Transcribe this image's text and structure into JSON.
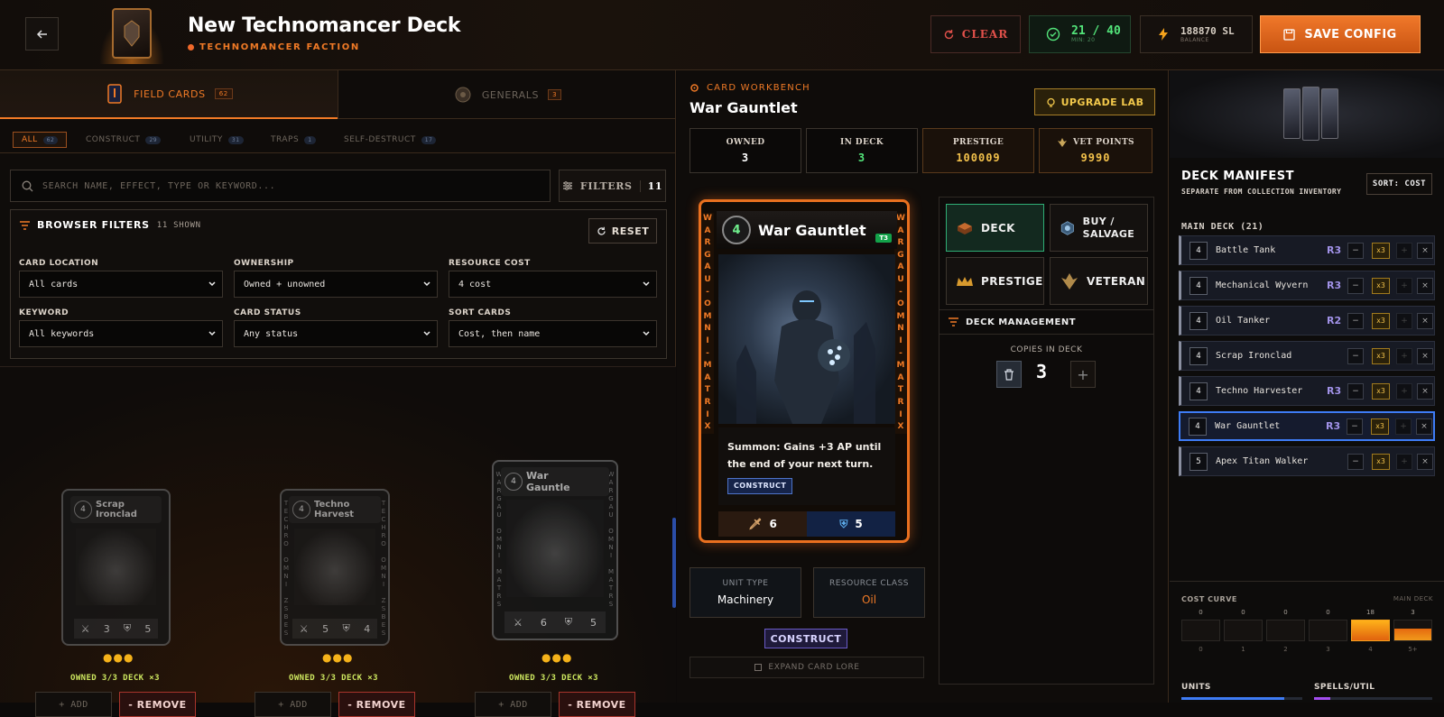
{
  "header": {
    "title": "New Technomancer Deck",
    "faction": "TECHNOMANCER FACTION",
    "clear_label": "CLEAR",
    "count": "21 / 40",
    "count_min": "MIN: 20",
    "balance": "188870 SL",
    "balance_label": "BALANCE",
    "save_label": "SAVE CONFIG"
  },
  "tabs": [
    {
      "label": "FIELD CARDS",
      "count": "62"
    },
    {
      "label": "GENERALS",
      "count": "3"
    }
  ],
  "subtabs": [
    {
      "label": "ALL",
      "count": "62"
    },
    {
      "label": "CONSTRUCT",
      "count": "29"
    },
    {
      "label": "UTILITY",
      "count": "31"
    },
    {
      "label": "TRAPS",
      "count": "1"
    },
    {
      "label": "SELF-DESTRUCT",
      "count": "17"
    }
  ],
  "search": {
    "placeholder": "SEARCH NAME, EFFECT, TYPE OR KEYWORD..."
  },
  "filters": {
    "button_label": "FILTERS",
    "button_count": "11",
    "panel_title": "BROWSER FILTERS",
    "shown": "11 SHOWN",
    "reset_label": "RESET",
    "fields": [
      {
        "label": "CARD LOCATION",
        "value": "All cards"
      },
      {
        "label": "OWNERSHIP",
        "value": "Owned + unowned"
      },
      {
        "label": "RESOURCE COST",
        "value": "4 cost"
      },
      {
        "label": "KEYWORD",
        "value": "All keywords"
      },
      {
        "label": "CARD STATUS",
        "value": "Any status"
      },
      {
        "label": "SORT CARDS",
        "value": "Cost, then name"
      }
    ]
  },
  "cards": [
    {
      "cost": "4",
      "name_1": "Scrap",
      "name_2": "Ironclad",
      "atk": "3",
      "def": "5",
      "owned": "OWNED 3/3 DECK ×3",
      "add": "+ ADD",
      "remove": "- REMOVE",
      "side": "T\nE\nC\nH\nN\nO\n \nZ\nB\nS\nE\nS"
    },
    {
      "cost": "4",
      "name_1": "Techno",
      "name_2": "Harvest",
      "tier": "T3",
      "atk": "5",
      "def": "4",
      "owned": "OWNED 3/3 DECK ×3",
      "add": "+ ADD",
      "remove": "- REMOVE",
      "side": "T\nE\nC\nH\nR\nO\n \nO\nM\nN\nI\n \nZ\nS\nB\nE\nS"
    },
    {
      "cost": "4",
      "name_1": "War",
      "name_2": "Gauntle",
      "tier": "T3",
      "atk": "6",
      "def": "5",
      "owned": "OWNED 3/3 DECK ×3",
      "add": "+ ADD",
      "remove": "- REMOVE",
      "side": "W\nA\nR\nG\nA\nU\n \nO\nM\nN\nI\n \nM\nA\nT\nR\nS"
    }
  ],
  "workbench": {
    "label": "CARD WORKBENCH",
    "title": "War Gauntlet",
    "upgrade_label": "UPGRADE LAB",
    "stats": [
      {
        "label": "OWNED",
        "value": "3"
      },
      {
        "label": "IN DECK",
        "value": "3"
      },
      {
        "label": "PRESTIGE",
        "value": "100009"
      },
      {
        "label": "VET POINTS",
        "value": "9990"
      }
    ],
    "card": {
      "cost": "4",
      "name": "War Gauntlet",
      "tier": "T3",
      "side_text": "W\nA\nR\nG\nA\nU\n-\nO\nM\nN\nI\n-\nM\nA\nT\nR\nI\nX",
      "text": "Summon: Gains +3 AP until the end of your next turn.",
      "tag": "CONSTRUCT",
      "atk": "6",
      "def": "5"
    },
    "unit_type_label": "UNIT TYPE",
    "unit_type": "Machinery",
    "resource_label": "RESOURCE CLASS",
    "resource": "Oil",
    "class_tag": "CONSTRUCT",
    "lore_label": "EXPAND CARD LORE",
    "actions": [
      "DECK",
      "BUY / SALVAGE",
      "PRESTIGE",
      "VETERAN"
    ],
    "management_label": "DECK MANAGEMENT",
    "copies_label": "COPIES IN DECK",
    "copies": "3"
  },
  "manifest": {
    "title": "DECK MANIFEST",
    "subtitle": "SEPARATE FROM COLLECTION INVENTORY",
    "sort_label": "SORT: COST",
    "main_deck_label": "MAIN DECK (21)",
    "rows": [
      {
        "cost": "4",
        "name": "Battle Tank",
        "rarity": "R3",
        "qty": "x3"
      },
      {
        "cost": "4",
        "name": "Mechanical Wyvern",
        "rarity": "R3",
        "qty": "x3"
      },
      {
        "cost": "4",
        "name": "Oil Tanker",
        "rarity": "R2",
        "qty": "x3"
      },
      {
        "cost": "4",
        "name": "Scrap Ironclad",
        "rarity": "",
        "qty": "x3"
      },
      {
        "cost": "4",
        "name": "Techno Harvester",
        "rarity": "R3",
        "qty": "x3"
      },
      {
        "cost": "4",
        "name": "War Gauntlet",
        "rarity": "R3",
        "qty": "x3"
      },
      {
        "cost": "5",
        "name": "Apex Titan Walker",
        "rarity": "",
        "qty": "x3"
      }
    ],
    "cost_curve_label": "COST CURVE",
    "curve_mode": "MAIN DECK",
    "curve": [
      {
        "label": "0",
        "count": "0"
      },
      {
        "label": "1",
        "count": "0"
      },
      {
        "label": "2",
        "count": "0"
      },
      {
        "label": "3",
        "count": "0"
      },
      {
        "label": "4",
        "count": "18"
      },
      {
        "label": "5+",
        "count": "3"
      }
    ],
    "units_label": "UNITS",
    "units_fill": 0.85,
    "spells_label": "SPELLS/UTIL",
    "spells_fill": 0.14
  },
  "colors": {
    "accent": "#f07a26",
    "save": "#e56a1f",
    "ok": "#53e47a",
    "select": "#3e7cf5"
  }
}
